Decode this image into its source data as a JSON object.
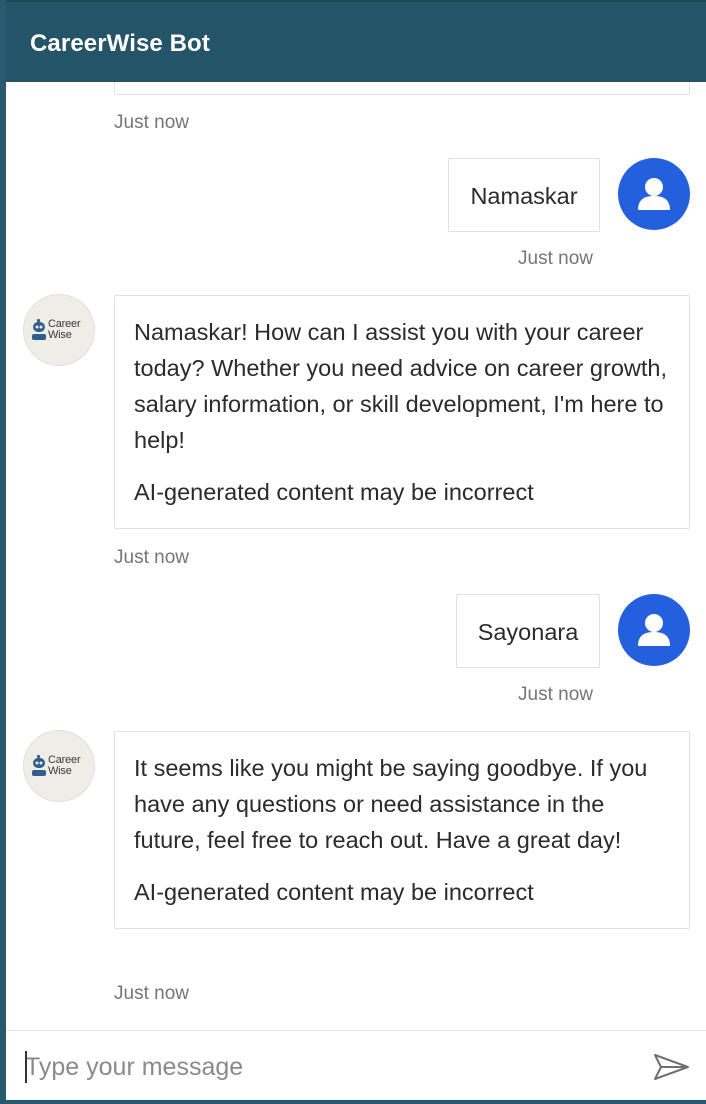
{
  "header": {
    "title": "CareerWise Bot"
  },
  "bot": {
    "logo_text_line1": "Career",
    "logo_text_line2": "Wise"
  },
  "transcript": {
    "partial_message_timestamp": "Just now",
    "messages": [
      {
        "from": "user",
        "text": "Namaskar",
        "timestamp": "Just now"
      },
      {
        "from": "bot",
        "text": "Namaskar! How can I assist you with your career today? Whether you need advice on career growth, salary information, or skill development, I'm here to help!",
        "disclaimer": "AI-generated content may be incorrect",
        "timestamp": "Just now"
      },
      {
        "from": "user",
        "text": "Sayonara",
        "timestamp": "Just now"
      },
      {
        "from": "bot",
        "text": "It seems like you might be saying goodbye. If you have any questions or need assistance in the future, feel free to reach out. Have a great day!",
        "disclaimer": "AI-generated content may be incorrect",
        "timestamp": "Just now"
      }
    ]
  },
  "composer": {
    "placeholder": "Type your message",
    "value": ""
  },
  "icons": {
    "user_avatar": "person-icon",
    "bot_avatar": "careerwise-logo",
    "send": "send-arrow-icon"
  },
  "colors": {
    "header_bg": "#245468",
    "user_avatar_bg": "#2460de",
    "bot_avatar_bg": "#eeede7"
  }
}
